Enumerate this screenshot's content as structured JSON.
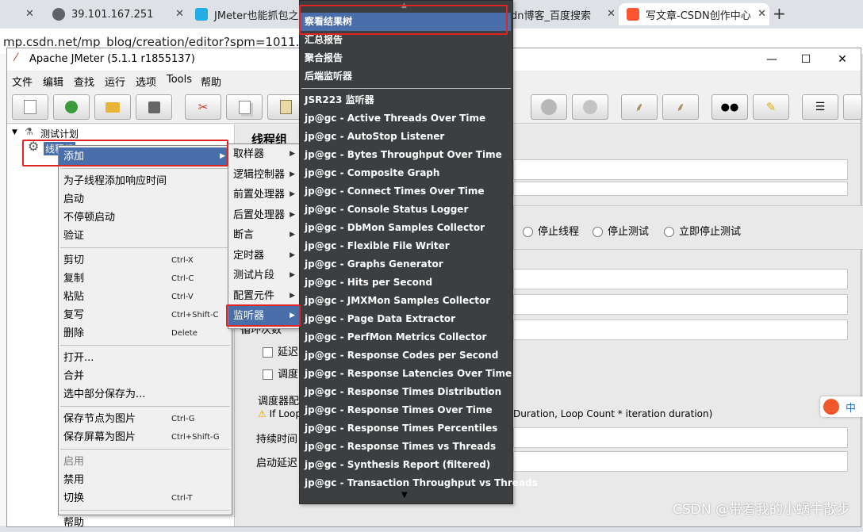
{
  "browser": {
    "tabs": [
      {
        "title": "39.101.167.251"
      },
      {
        "title": "JMeter也能抓包之许"
      },
      {
        "title": "dn博客_百度搜索"
      },
      {
        "title": "写文章-CSDN创作中心"
      }
    ],
    "new_tab_glyph": "+",
    "close_glyph": "✕",
    "url": "mp.csdn.net/mp_blog/creation/editor?spm=1011.2124"
  },
  "jmeter": {
    "title": "Apache JMeter (5.1.1 r1855137)",
    "window_buttons": {
      "minimize": "—",
      "maximize": "☐",
      "close": "✕"
    },
    "menus": [
      "文件",
      "编辑",
      "查找",
      "运行",
      "选项",
      "Tools",
      "帮助"
    ],
    "tree": {
      "root": "测试计划",
      "node": "线程组"
    },
    "right_panel": {
      "title": "线程组",
      "radios": [
        "停止线程",
        "停止测试",
        "立即停止测试"
      ],
      "checkbox_labels": [
        "延迟",
        "调度"
      ],
      "section_title": "调度器配",
      "warning_prefix": "If Loop",
      "warning_suffix": "Duration, Loop Count * iteration duration)",
      "duration_label": "持续时间",
      "startup_delay_label": "启动延迟",
      "loop_label": "循环次数"
    }
  },
  "context_menu": {
    "items": [
      {
        "label": "添加",
        "submenu": true,
        "selected": true
      },
      {
        "sep": true
      },
      {
        "label": "为子线程添加响应时间"
      },
      {
        "label": "启动"
      },
      {
        "label": "不停顿启动"
      },
      {
        "label": "验证"
      },
      {
        "sep": true
      },
      {
        "label": "剪切",
        "shortcut": "Ctrl-X"
      },
      {
        "label": "复制",
        "shortcut": "Ctrl-C"
      },
      {
        "label": "粘贴",
        "shortcut": "Ctrl-V"
      },
      {
        "label": "复写",
        "shortcut": "Ctrl+Shift-C"
      },
      {
        "label": "删除",
        "shortcut": "Delete"
      },
      {
        "sep": true
      },
      {
        "label": "打开..."
      },
      {
        "label": "合并"
      },
      {
        "label": "选中部分保存为..."
      },
      {
        "sep": true
      },
      {
        "label": "保存节点为图片",
        "shortcut": "Ctrl-G"
      },
      {
        "label": "保存屏幕为图片",
        "shortcut": "Ctrl+Shift-G"
      },
      {
        "sep": true
      },
      {
        "label": "启用",
        "disabled": true
      },
      {
        "label": "禁用"
      },
      {
        "label": "切换",
        "shortcut": "Ctrl-T"
      },
      {
        "sep": true
      },
      {
        "label": "帮助"
      }
    ]
  },
  "add_submenu": {
    "items": [
      {
        "label": "取样器"
      },
      {
        "label": "逻辑控制器"
      },
      {
        "label": "前置处理器"
      },
      {
        "label": "后置处理器"
      },
      {
        "label": "断言"
      },
      {
        "label": "定时器"
      },
      {
        "label": "测试片段"
      },
      {
        "label": "配置元件"
      },
      {
        "label": "监听器",
        "selected": true
      }
    ]
  },
  "listener_submenu": {
    "scroll_up_glyph": "▲",
    "scroll_down_glyph": "▼",
    "items": [
      {
        "label": "察看结果树",
        "selected": true
      },
      {
        "label": "汇总报告"
      },
      {
        "label": "聚合报告"
      },
      {
        "label": "后端监听器"
      },
      {
        "sep": true
      },
      {
        "label": "JSR223 监听器"
      },
      {
        "label": "jp@gc - Active Threads Over Time"
      },
      {
        "label": "jp@gc - AutoStop Listener"
      },
      {
        "label": "jp@gc - Bytes Throughput Over Time"
      },
      {
        "label": "jp@gc - Composite Graph"
      },
      {
        "label": "jp@gc - Connect Times Over Time"
      },
      {
        "label": "jp@gc - Console Status Logger"
      },
      {
        "label": "jp@gc - DbMon Samples Collector"
      },
      {
        "label": "jp@gc - Flexible File Writer"
      },
      {
        "label": "jp@gc - Graphs Generator"
      },
      {
        "label": "jp@gc - Hits per Second"
      },
      {
        "label": "jp@gc - JMXMon Samples Collector"
      },
      {
        "label": "jp@gc - Page Data Extractor"
      },
      {
        "label": "jp@gc - PerfMon Metrics Collector"
      },
      {
        "label": "jp@gc - Response Codes per Second"
      },
      {
        "label": "jp@gc - Response Latencies Over Time"
      },
      {
        "label": "jp@gc - Response Times Distribution"
      },
      {
        "label": "jp@gc - Response Times Over Time"
      },
      {
        "label": "jp@gc - Response Times Percentiles"
      },
      {
        "label": "jp@gc - Response Times vs Threads"
      },
      {
        "label": "jp@gc - Synthesis Report (filtered)"
      },
      {
        "label": "jp@gc - Transaction Throughput vs Threads"
      }
    ]
  },
  "watermark": "CSDN @带着我的小蜗牛散步",
  "colors": {
    "selection": "#4a6ea9",
    "highlight_box": "#e02424",
    "listener_menu_bg": "#3c3f41"
  }
}
